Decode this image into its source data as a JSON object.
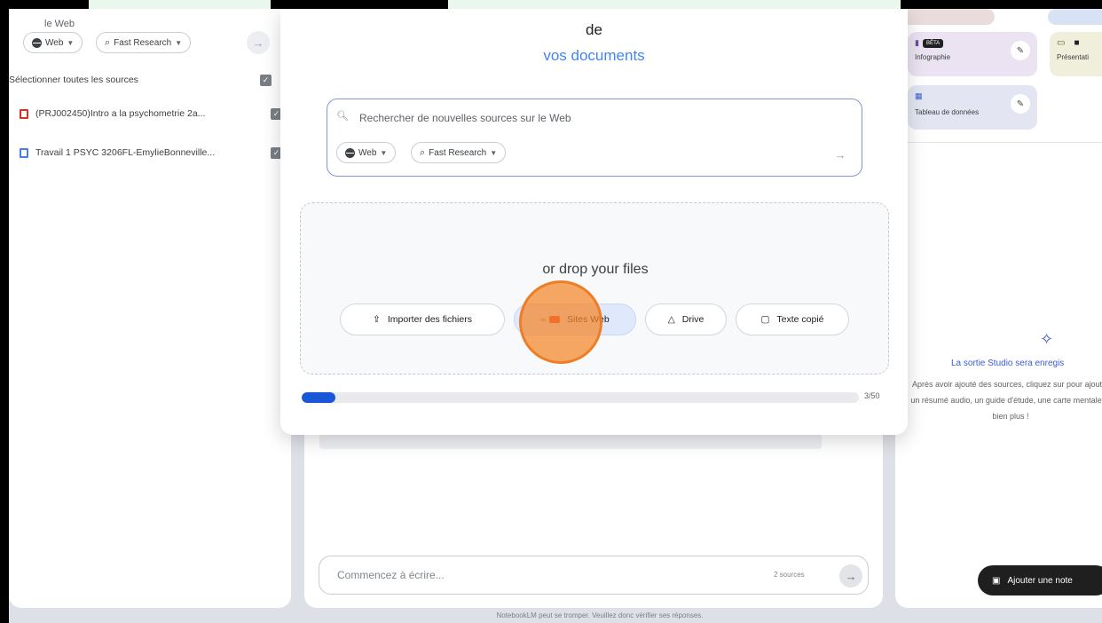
{
  "sources_panel": {
    "web_label": "le Web",
    "chip_web": "Web",
    "chip_research": "Fast Research",
    "select_all": "Sélectionner toutes les sources",
    "items": [
      {
        "title": "(PRJ002450)Intro a la psychometrie 2a...",
        "type": "pdf"
      },
      {
        "title": "Travail 1 PSYC 3206FL-EmylieBonneville...",
        "type": "doc"
      }
    ]
  },
  "modal": {
    "title_line1": "de",
    "title_line2": "vos documents",
    "search_placeholder": "Rechercher de nouvelles sources sur le Web",
    "chip_web": "Web",
    "chip_research": "Fast Research",
    "drop_text": "or drop your files",
    "buttons": {
      "upload": "Importer des fichiers",
      "websites": "Sites Web",
      "drive": "Drive",
      "pasted_text": "Texte copié"
    },
    "progress": {
      "value": 3,
      "max": 50,
      "label": "3/50"
    }
  },
  "chat": {
    "placeholder": "Commencez à écrire...",
    "sources_count": "2 sources"
  },
  "studio": {
    "card1_label": "Infographie",
    "card1_badge": "BÊTA",
    "card2_label": "Présentati",
    "card3_label": "Tableau de données",
    "empty_title": "La sortie Studio sera enregis",
    "empty_desc": "Après avoir ajouté des sources, cliquez sur pour ajouter un résumé audio, un guide d'étude, une carte mentale et bien plus !",
    "add_note": "Ajouter une note"
  },
  "footer": "NotebookLM peut se tromper. Veuillez donc vérifier ses réponses.",
  "colors": {
    "accent_blue": "#1a57d6",
    "click_indicator": "#f58528"
  }
}
